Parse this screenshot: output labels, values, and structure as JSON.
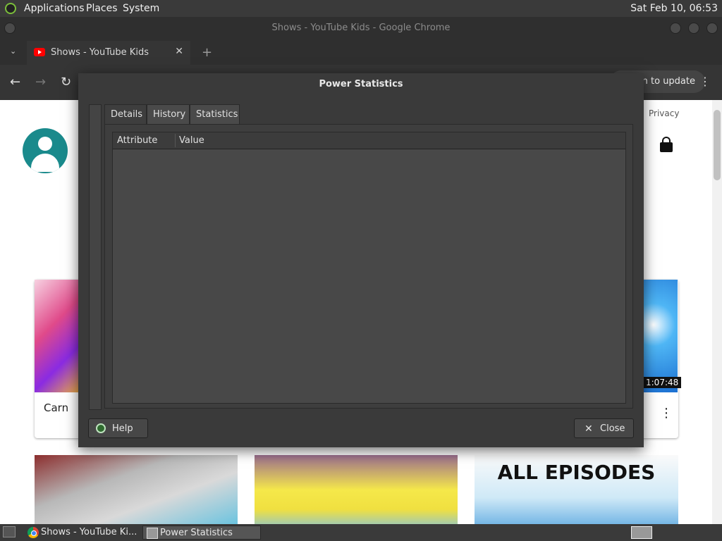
{
  "top_panel": {
    "applications": "Applications",
    "places": "Places",
    "system": "System",
    "clock": "Sat Feb 10, 06:53"
  },
  "chrome": {
    "window_title": "Shows - YouTube Kids - Google Chrome",
    "tab_title": "Shows - YouTube Kids",
    "tab_close": "✕",
    "new_tab": "+",
    "tab_dropdown": "⌄",
    "back": "←",
    "forward": "→",
    "reload": "↻",
    "update_label": "nch to update",
    "menu": "⋮"
  },
  "page": {
    "privacy": "Privacy",
    "card1_label": "Carn",
    "duration": "1:07:48",
    "card_menu": "⋮",
    "thumb_c_title": "ALL EPISODES"
  },
  "dialog": {
    "title": "Power Statistics",
    "tabs": [
      "Details",
      "History",
      "Statistics"
    ],
    "columns": [
      "Attribute",
      "Value"
    ],
    "help": "Help",
    "close": "Close",
    "close_glyph": "✕"
  },
  "taskbar": {
    "chrome_task": "Shows - YouTube Ki...",
    "power_task": "Power Statistics"
  },
  "colors": {
    "accent": "#7bbf3a",
    "youtube_red": "#ff0000",
    "avatar_teal": "#1a8a8c"
  }
}
